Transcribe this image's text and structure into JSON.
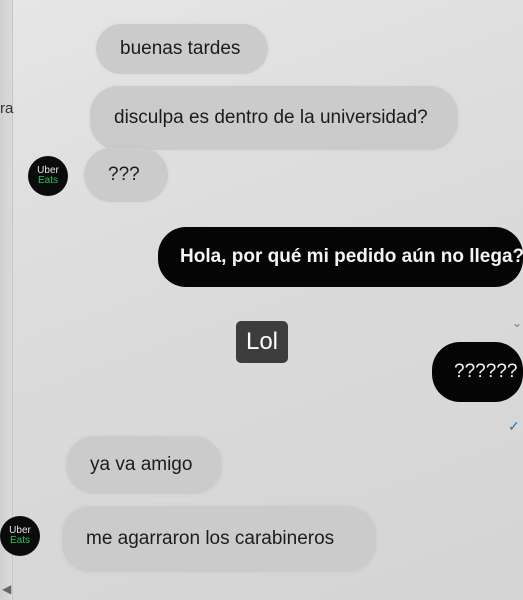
{
  "side_label": "ra",
  "messages": [
    {
      "text": "buenas tardes"
    },
    {
      "text": "disculpa es dentro de la universidad?"
    },
    {
      "text": "???"
    },
    {
      "text": "Hola, por qué mi pedido aún no llega?"
    },
    {
      "text": "??????"
    },
    {
      "text": "ya va amigo"
    },
    {
      "text": "me agarraron los carabineros"
    }
  ],
  "avatar": {
    "line1": "Uber",
    "line2": "Eats"
  },
  "overlay_label": "Lol",
  "colors": {
    "background": "#dcdcdc",
    "incoming_bubble": "#cbcbcb",
    "outgoing_bubble": "#050505",
    "eats_green": "#22c55e",
    "read_check": "#2f6ea8"
  },
  "icons": [
    "uber-eats-avatar",
    "read-check-icon",
    "scroll-left-icon"
  ]
}
